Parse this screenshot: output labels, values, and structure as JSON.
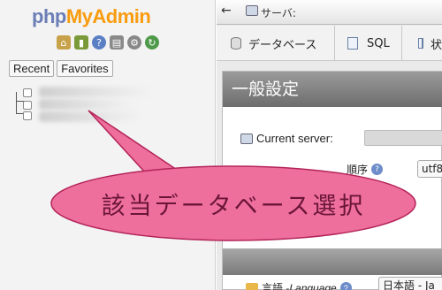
{
  "nav_panel": {
    "logo_php": "php",
    "logo_myadmin": "MyAdmin",
    "icons": [
      {
        "name": "home-icon",
        "glyph": "⌂",
        "color": "#c8a24a"
      },
      {
        "name": "exit-icon",
        "glyph": "▮",
        "color": "#7a9a3a"
      },
      {
        "name": "help-icon",
        "glyph": "?",
        "color": "#5b7fc4"
      },
      {
        "name": "docs-icon",
        "glyph": "▤",
        "color": "#8a8a8a"
      },
      {
        "name": "settings-icon",
        "glyph": "⚙",
        "color": "#888888"
      },
      {
        "name": "reload-icon",
        "glyph": "↻",
        "color": "#4f9a4a"
      }
    ],
    "recent_label": "Recent",
    "favorites_label": "Favorites"
  },
  "main_panel": {
    "back_arrow": "←",
    "server_label": "サーバ:",
    "tabs": [
      {
        "label": "データベース"
      },
      {
        "label": "SQL"
      },
      {
        "label": "状"
      }
    ],
    "general_settings_title": "一般設定",
    "current_server_label": "Current server:",
    "collation_label": "順序",
    "collation_value": "utf8",
    "language_label": "言語 - ",
    "language_label_en": "Language",
    "language_value": "日本語 - Ja"
  },
  "callout": {
    "text": "該当データベース選択",
    "fill": "#ee6f9b"
  }
}
